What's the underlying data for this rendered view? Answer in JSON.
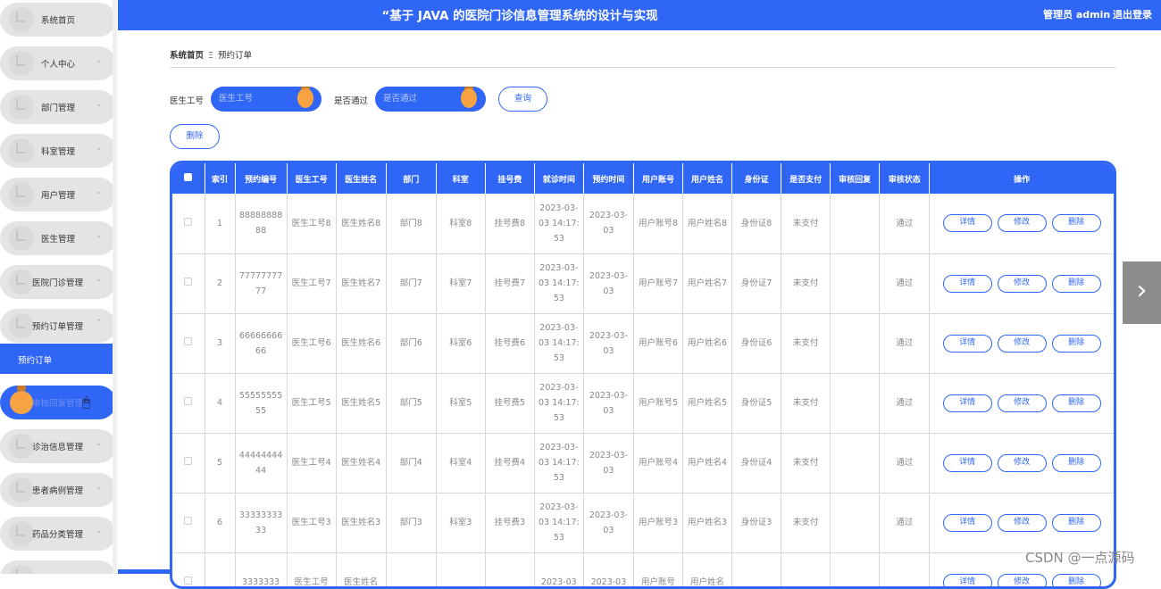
{
  "header": {
    "title": "“基于 JAVA 的医院门诊信息管理系统的设计与实现",
    "user": "管理员 admin",
    "logout": "退出登录"
  },
  "sidebar": {
    "items": [
      {
        "label": "系统首页",
        "chevron": ""
      },
      {
        "label": "个人中心",
        "chevron": "⌄"
      },
      {
        "label": "部门管理",
        "chevron": "⌄"
      },
      {
        "label": "科室管理",
        "chevron": "⌄"
      },
      {
        "label": "用户管理",
        "chevron": "⌄"
      },
      {
        "label": "医生管理",
        "chevron": "⌄"
      },
      {
        "label": "医院门诊管理",
        "chevron": "⌄"
      },
      {
        "label": "预约订单管理",
        "chevron": "⌃"
      },
      {
        "label": "审核回复管理",
        "chevron": ""
      },
      {
        "label": "诊治信息管理",
        "chevron": "⌄"
      },
      {
        "label": "患者病例管理",
        "chevron": "⌄"
      },
      {
        "label": "药品分类管理",
        "chevron": "⌄"
      }
    ],
    "active_sub": "预约订单"
  },
  "breadcrumb": {
    "home": "系统首页",
    "sep": "Ξ",
    "current": "预约订单"
  },
  "search": {
    "doctor_label": "医生工号",
    "doctor_placeholder": "医生工号",
    "approve_label": "是否通过",
    "approve_placeholder": "是否通过",
    "query_button": "查询",
    "delete_button": "删除"
  },
  "table": {
    "headers": [
      "索引",
      "预约编号",
      "医生工号",
      "医生姓名",
      "部门",
      "科室",
      "挂号费",
      "就诊时间",
      "预约时间",
      "用户账号",
      "用户姓名",
      "身份证",
      "是否支付",
      "审核回复",
      "审核状态",
      "操作"
    ],
    "actions": {
      "detail": "详情",
      "edit": "修改",
      "delete": "删除"
    },
    "rows": [
      [
        "1",
        "8888888888",
        "医生工号8",
        "医生姓名8",
        "部门8",
        "科室8",
        "挂号费8",
        "2023-03-03 14:17:53",
        "2023-03-03",
        "用户账号8",
        "用户姓名8",
        "身份证8",
        "未支付",
        "",
        "通过"
      ],
      [
        "2",
        "7777777777",
        "医生工号7",
        "医生姓名7",
        "部门7",
        "科室7",
        "挂号费7",
        "2023-03-03 14:17:53",
        "2023-03-03",
        "用户账号7",
        "用户姓名7",
        "身份证7",
        "未支付",
        "",
        "通过"
      ],
      [
        "3",
        "6666666666",
        "医生工号6",
        "医生姓名6",
        "部门6",
        "科室6",
        "挂号费6",
        "2023-03-03 14:17:53",
        "2023-03-03",
        "用户账号6",
        "用户姓名6",
        "身份证6",
        "未支付",
        "",
        "通过"
      ],
      [
        "4",
        "5555555555",
        "医生工号5",
        "医生姓名5",
        "部门5",
        "科室5",
        "挂号费5",
        "2023-03-03 14:17:53",
        "2023-03-03",
        "用户账号5",
        "用户姓名5",
        "身份证5",
        "未支付",
        "",
        "通过"
      ],
      [
        "5",
        "4444444444",
        "医生工号4",
        "医生姓名4",
        "部门4",
        "科室4",
        "挂号费4",
        "2023-03-03 14:17:53",
        "2023-03-03",
        "用户账号4",
        "用户姓名4",
        "身份证4",
        "未支付",
        "",
        "通过"
      ],
      [
        "6",
        "3333333333",
        "医生工号3",
        "医生姓名3",
        "部门3",
        "科室3",
        "挂号费3",
        "2023-03-03 14:17:53",
        "2023-03-03",
        "用户账号3",
        "用户姓名3",
        "身份证3",
        "未支付",
        "",
        "通过"
      ],
      [
        "",
        "3333333",
        "医生工号",
        "医生姓名",
        "",
        "",
        "",
        "2023-03",
        "2023-03",
        "用户账号",
        "用户姓名",
        "",
        "",
        "",
        ""
      ]
    ]
  },
  "pager": {
    "next": "›"
  },
  "watermark": "CSDN @一点源码",
  "colors": {
    "primary": "#2f66f5",
    "accent": "#f7a342"
  }
}
